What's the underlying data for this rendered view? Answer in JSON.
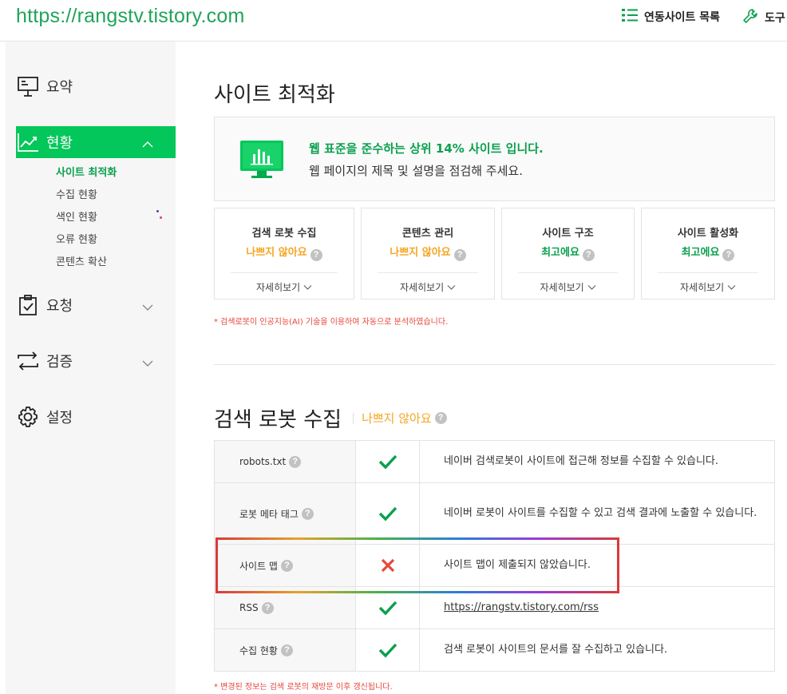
{
  "header": {
    "site_url": "https://rangstv.tistory.com",
    "sites_label": "연동사이트 목록",
    "tools_label": "도구"
  },
  "sidebar": {
    "summary_label": "요약",
    "status_label": "현황",
    "status_sub": [
      "사이트 최적화",
      "수집 현황",
      "색인 현황",
      "오류 현황",
      "콘텐츠 확산"
    ],
    "request_label": "요청",
    "verify_label": "검증",
    "settings_label": "설정"
  },
  "main": {
    "title": "사이트 최적화",
    "summary_headline": "웹 표준을 준수하는 상위 14% 사이트 입니다.",
    "summary_sub": "웹 페이지의 제목 및 설명을 점검해 주세요.",
    "cards": [
      {
        "title": "검색 로봇 수집",
        "status": "나쁘지 않아요",
        "kind": "bad",
        "more": "자세히보기"
      },
      {
        "title": "콘텐츠 관리",
        "status": "나쁘지 않아요",
        "kind": "bad",
        "more": "자세히보기"
      },
      {
        "title": "사이트 구조",
        "status": "최고에요",
        "kind": "good",
        "more": "자세히보기"
      },
      {
        "title": "사이트 활성화",
        "status": "최고에요",
        "kind": "good",
        "more": "자세히보기"
      }
    ],
    "ai_note": "* 검색로봇이 인공지능(AI) 기술을 이용하여 자동으로 분석하였습니다.",
    "section_title": "검색 로봇 수집",
    "section_status": "나쁘지 않아요",
    "rows": [
      {
        "label": "robots.txt",
        "result": "pass",
        "desc": "네이버 검색로봇이 사이트에 접근해 정보를 수집할 수 있습니다."
      },
      {
        "label": "로봇 메타 태그",
        "result": "pass",
        "desc": "네이버 로봇이 사이트를 수집할 수 있고 검색 결과에 노출할 수 있습니다."
      },
      {
        "label": "사이트 맵",
        "result": "fail",
        "desc": "사이트 맵이 제출되지 않았습니다."
      },
      {
        "label": "RSS",
        "result": "pass",
        "desc": "https://rangstv.tistory.com/rss"
      },
      {
        "label": "수집 현황",
        "result": "pass",
        "desc": "검색 로봇이 사이트의 문서를 잘 수집하고 있습니다."
      }
    ],
    "update_note": "* 변경된 정보는 검색 로봇의 재방문 이후 갱신됩니다."
  },
  "colors": {
    "accent": "#03c75a",
    "good": "#0aa04e",
    "warn": "#f5a623",
    "fail": "#e8463c"
  }
}
